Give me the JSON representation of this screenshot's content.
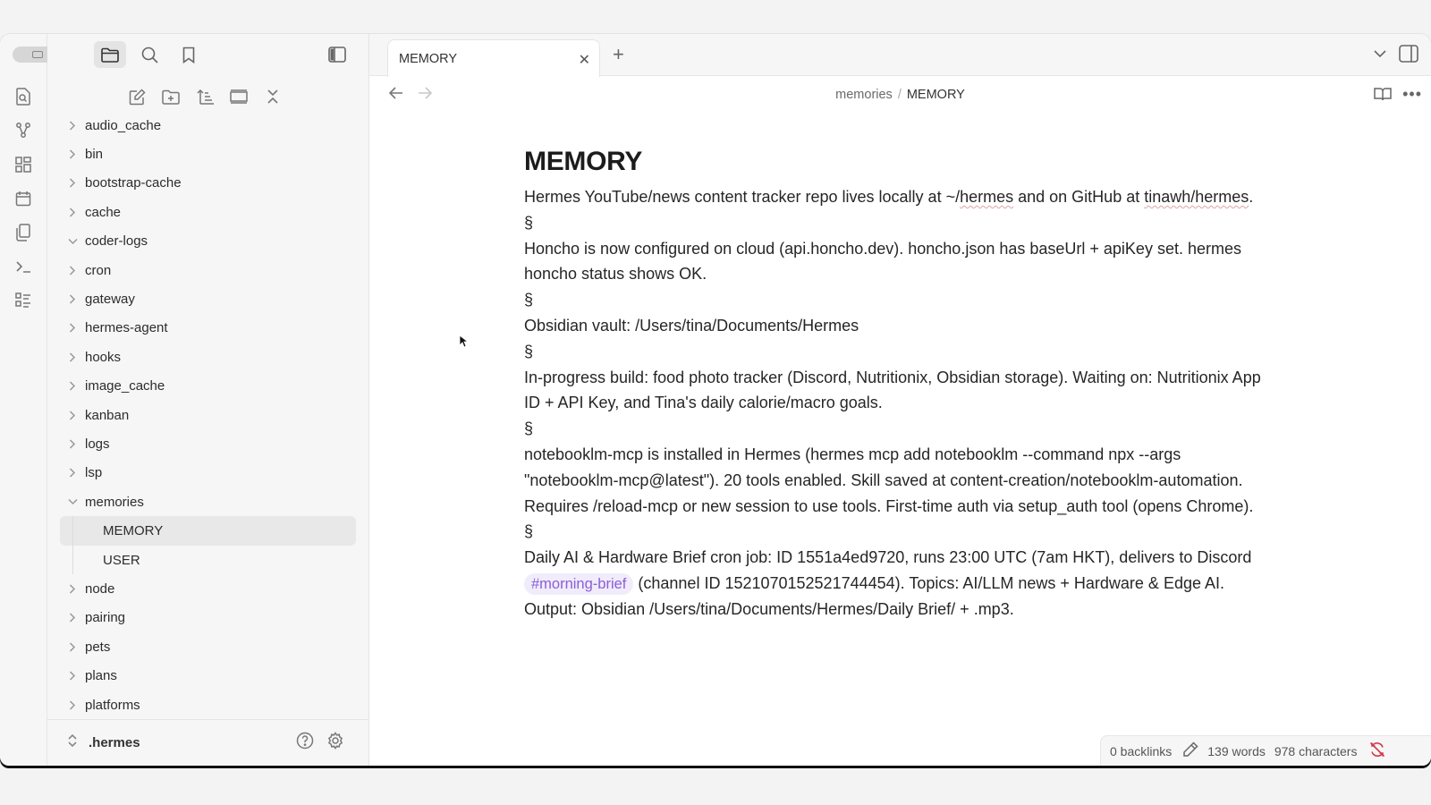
{
  "sidebar": {
    "tree": [
      {
        "label": "audio_cache",
        "expanded": false
      },
      {
        "label": "bin",
        "expanded": false
      },
      {
        "label": "bootstrap-cache",
        "expanded": false
      },
      {
        "label": "cache",
        "expanded": false
      },
      {
        "label": "coder-logs",
        "expanded": true
      },
      {
        "label": "cron",
        "expanded": false
      },
      {
        "label": "gateway",
        "expanded": false
      },
      {
        "label": "hermes-agent",
        "expanded": false
      },
      {
        "label": "hooks",
        "expanded": false
      },
      {
        "label": "image_cache",
        "expanded": false
      },
      {
        "label": "kanban",
        "expanded": false
      },
      {
        "label": "logs",
        "expanded": false
      },
      {
        "label": "lsp",
        "expanded": false
      },
      {
        "label": "memories",
        "expanded": true
      },
      {
        "label": "MEMORY",
        "child": true,
        "selected": true
      },
      {
        "label": "USER",
        "child": true
      },
      {
        "label": "node",
        "expanded": false
      },
      {
        "label": "pairing",
        "expanded": false
      },
      {
        "label": "pets",
        "expanded": false
      },
      {
        "label": "plans",
        "expanded": false
      },
      {
        "label": "platforms",
        "expanded": false
      }
    ],
    "vault_name": ".hermes"
  },
  "tabs": [
    {
      "label": "MEMORY",
      "close": "✕"
    }
  ],
  "add_tab": "+",
  "breadcrumb": {
    "folder": "memories",
    "separator": "/",
    "current": "MEMORY"
  },
  "doc": {
    "title": "MEMORY",
    "p1_pre": "Hermes YouTube/news content tracker repo lives locally at ~/",
    "p1_squig1": "hermes",
    "p1_mid": " and on GitHub at ",
    "p1_squig2": "tinawh/hermes",
    "p1_post": ".",
    "sep": "§",
    "p2": "Honcho is now configured on cloud (api.honcho.dev). honcho.json has baseUrl + apiKey set. hermes honcho status shows OK.",
    "p3": "Obsidian vault: /Users/tina/Documents/Hermes",
    "p4": "In-progress build: food photo tracker (Discord, Nutritionix, Obsidian storage). Waiting on: Nutritionix App ID + API Key, and Tina's daily calorie/macro goals.",
    "p5": "notebooklm-mcp is installed in Hermes (hermes mcp add notebooklm --command npx --args \"notebooklm-mcp@latest\"). 20 tools enabled. Skill saved at content-creation/notebooklm-automation. Requires /reload-mcp or new session to use tools. First-time auth via setup_auth tool (opens Chrome).",
    "p6_pre": "Daily AI & Hardware Brief cron job: ID 1551a4ed9720, runs 23:00 UTC (7am HKT), delivers to Discord ",
    "p6_tag": "#morning-brief",
    "p6_post": " (channel ID 1521070152521744454). Topics: AI/LLM news + Hardware & Edge AI. Output: Obsidian /Users/tina/Documents/Hermes/Daily Brief/ + .mp3."
  },
  "status": {
    "backlinks": "0 backlinks",
    "words": "139 words",
    "characters": "978 characters"
  },
  "colors": {
    "tag_bg": "#f1ecfb",
    "tag_text": "#8a5fd8",
    "sync_error": "#d23b4b"
  }
}
